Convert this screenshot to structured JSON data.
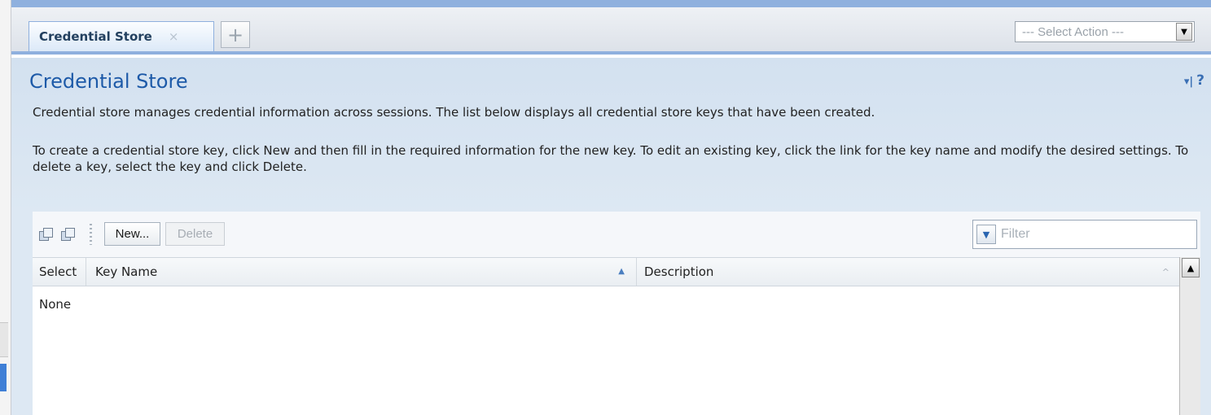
{
  "tabs": [
    {
      "label": "Credential Store",
      "close": "×"
    },
    {
      "label": "+"
    }
  ],
  "action_select": {
    "value": "--- Select Action ---"
  },
  "page": {
    "title": "Credential Store",
    "help": "?",
    "description_1": "Credential store manages credential information across sessions. The list below displays all credential store keys that have been created.",
    "description_2": "To create a credential store key, click New and then fill in the required information for the new key. To edit an existing key, click the link for the key name and modify the desired settings. To delete a key, select the key and click Delete."
  },
  "toolbar": {
    "new_label": "New...",
    "delete_label": "Delete",
    "filter_placeholder": "Filter"
  },
  "table": {
    "columns": [
      "Select",
      "Key Name",
      "Description"
    ],
    "empty_text": "None"
  },
  "icons": [
    "select-all-icon",
    "deselect-all-icon",
    "pin-icon",
    "filter-menu-icon",
    "sort-ascending-icon",
    "scroll-up-icon",
    "dropdown-arrow-icon",
    "close-icon",
    "plus-icon"
  ],
  "colors": {
    "title": "#1d5aa8",
    "tab_border": "#8fb0de",
    "content_bg": "#d3e1f0"
  }
}
